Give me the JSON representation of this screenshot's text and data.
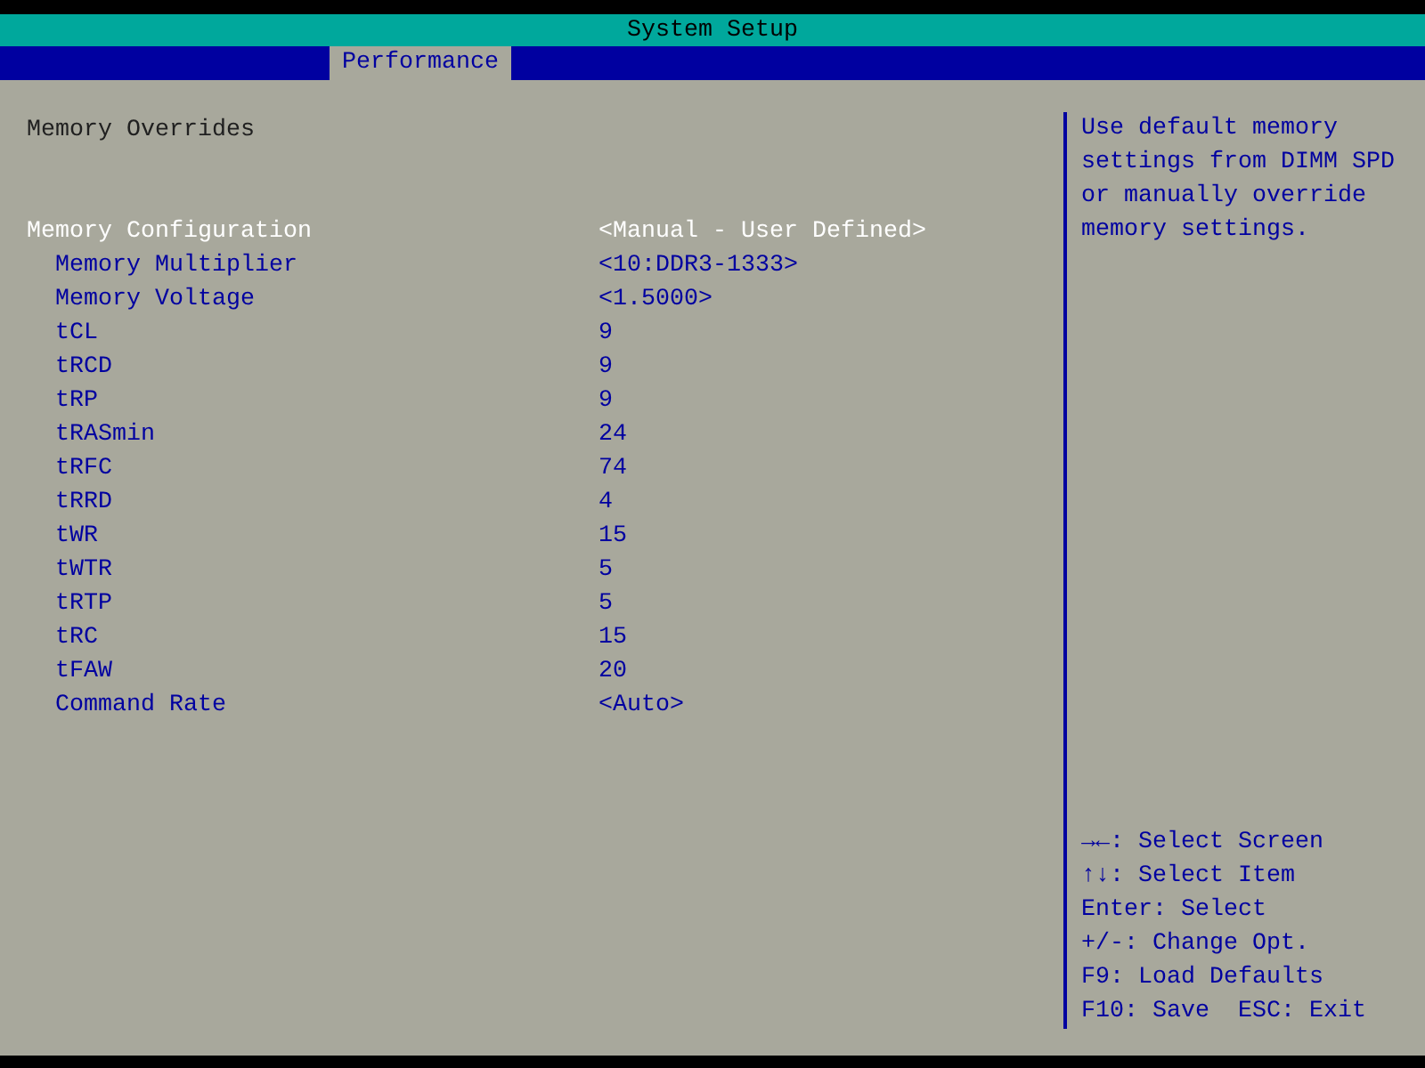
{
  "window": {
    "title": "System Setup"
  },
  "tabs": [
    {
      "label": "Performance",
      "selected": true
    }
  ],
  "section": {
    "heading": "Memory Overrides"
  },
  "settings": [
    {
      "label": "Memory Configuration",
      "value": "<Manual - User Defined>",
      "selected": true,
      "children": [
        {
          "label": "Memory Multiplier",
          "value": "<10:DDR3-1333>",
          "selected": false
        },
        {
          "label": "Memory Voltage",
          "value": "<1.5000>",
          "selected": false
        },
        {
          "label": "tCL",
          "value": "9",
          "selected": false
        },
        {
          "label": "tRCD",
          "value": "9",
          "selected": false
        },
        {
          "label": "tRP",
          "value": "9",
          "selected": false
        },
        {
          "label": "tRASmin",
          "value": "24",
          "selected": false
        },
        {
          "label": "tRFC",
          "value": "74",
          "selected": false
        },
        {
          "label": "tRRD",
          "value": "4",
          "selected": false
        },
        {
          "label": "tWR",
          "value": "15",
          "selected": false
        },
        {
          "label": "tWTR",
          "value": "5",
          "selected": false
        },
        {
          "label": "tRTP",
          "value": "5",
          "selected": false
        },
        {
          "label": "tRC",
          "value": "15",
          "selected": false
        },
        {
          "label": "tFAW",
          "value": "20",
          "selected": false
        },
        {
          "label": "Command Rate",
          "value": "<Auto>",
          "selected": false
        }
      ]
    }
  ],
  "help": {
    "text": "Use default memory settings from DIMM SPD or manually override memory settings."
  },
  "key_hints": [
    "→←: Select Screen",
    "↑↓: Select Item",
    "Enter: Select",
    "+/-: Change Opt.",
    "F9: Load Defaults",
    "F10: Save  ESC: Exit"
  ]
}
